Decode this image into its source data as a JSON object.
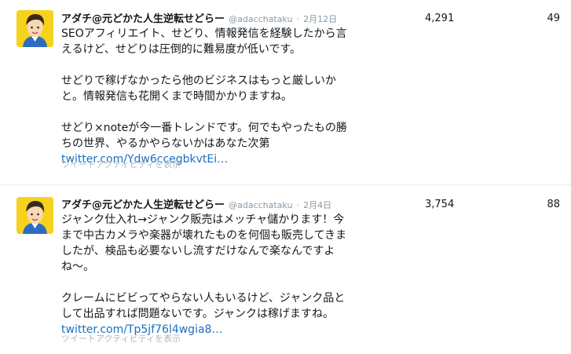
{
  "tweets": [
    {
      "fullname": "アダチ@元どかた人生逆転せどらー",
      "username": "@adacchataku",
      "separator": "·",
      "date": "2月12日",
      "lines_p1": [
        "SEOアフィリエイト、せどり、情報発信を経験したから言",
        "えるけど、せどりは圧倒的に難易度が低いです。"
      ],
      "lines_p2": [
        "せどりで稼げなかったら他のビジネスはもっと厳しいか",
        "と。情報発信も花開くまで時間かかりますね。"
      ],
      "lines_p3": [
        "せどり×noteが今一番トレンドです。何でもやったもの勝",
        "ちの世界、やるかやらないかはあなた次第"
      ],
      "link": "twitter.com/Ydw6ccegbkvtEi…",
      "activity": "ツイートアクティビティを表示",
      "impressions": "4,291",
      "engagements": "49"
    },
    {
      "fullname": "アダチ@元どかた人生逆転せどらー",
      "username": "@adacchataku",
      "separator": "·",
      "date": "2月4日",
      "lines_p1": [
        "ジャンク仕入れ→ジャンク販売はメッチャ儲かります！今",
        "まで中古カメラや楽器が壊れたものを何個も販売してきま",
        "したが、検品も必要ないし流すだけなんで楽なんですよ",
        "ね〜。"
      ],
      "lines_p2": [
        "クレームにビビってやらない人もいるけど、ジャンク品と",
        "して出品すれば問題ないです。ジャンクは稼げますね。"
      ],
      "link": "twitter.com/Tp5jf76l4wgia8…",
      "activity": "ツイートアクティビティを表示",
      "impressions": "3,754",
      "engagements": "88"
    }
  ]
}
